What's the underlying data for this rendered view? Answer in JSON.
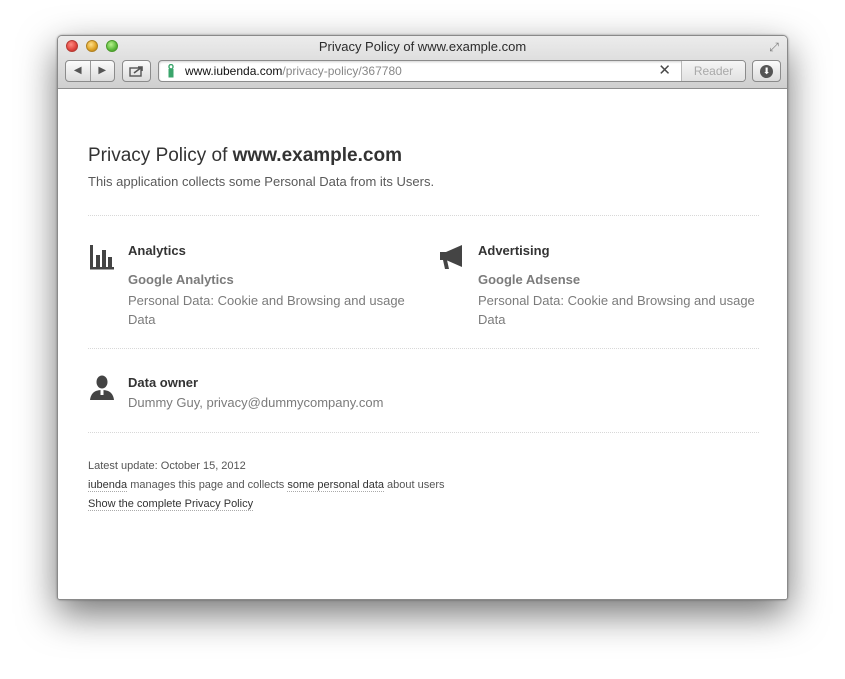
{
  "window": {
    "title": "Privacy Policy of www.example.com"
  },
  "toolbar": {
    "back_label": "◀",
    "forward_label": "▶",
    "url_host": "www.iubenda.com",
    "url_path": "/privacy-policy/367780",
    "reader_label": "Reader"
  },
  "page": {
    "title_prefix": "Privacy Policy of ",
    "title_site": "www.example.com",
    "subtitle": "This application collects some Personal Data from its Users.",
    "sections": [
      {
        "title": "Analytics",
        "icon": "bar-chart-icon",
        "service": "Google Analytics",
        "personal_data": "Personal Data: Cookie and Browsing and usage Data"
      },
      {
        "title": "Advertising",
        "icon": "megaphone-icon",
        "service": "Google Adsense",
        "personal_data": "Personal Data: Cookie and Browsing and usage Data"
      }
    ],
    "owner": {
      "icon": "person-icon",
      "title": "Data owner",
      "value": "Dummy Guy, privacy@dummycompany.com"
    },
    "footer": {
      "latest_update": "Latest update: October 15, 2012",
      "brand": "iubenda",
      "manages_text": " manages this page and collects ",
      "personal_data_link": "some personal data",
      "about_text": " about users",
      "full_policy_link": "Show the complete Privacy Policy"
    }
  }
}
